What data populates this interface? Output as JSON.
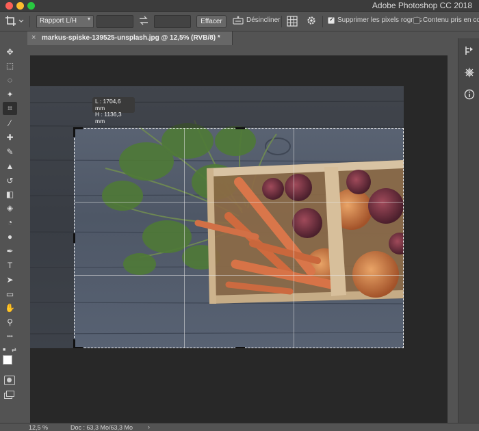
{
  "window": {
    "app_title": "Adobe Photoshop CC 2018"
  },
  "options_bar": {
    "ratio_select_value": "Rapport L/H",
    "width_value": "",
    "height_value": "",
    "clear_label": "Effacer",
    "straighten_label": "Désincliner",
    "delete_cropped_label": "Supprimer les pixels rognés",
    "delete_cropped_checked": true,
    "content_aware_label": "Contenu pris en comp",
    "content_aware_checked": false
  },
  "document": {
    "tab_title": "markus-spiske-139525-unsplash.jpg @ 12,5% (RVB/8) *"
  },
  "crop_tooltip": {
    "width_line": "L : 1704,6 mm",
    "height_line": "H : 1136,3 mm"
  },
  "toolbar": {
    "tools": [
      {
        "name": "move-tool-icon",
        "glyph": "✥"
      },
      {
        "name": "marquee-tool-icon",
        "glyph": "⬚"
      },
      {
        "name": "lasso-tool-icon",
        "glyph": "◌"
      },
      {
        "name": "magic-wand-tool-icon",
        "glyph": "✦"
      },
      {
        "name": "crop-tool-icon",
        "glyph": "⌗",
        "active": true
      },
      {
        "name": "eyedropper-tool-icon",
        "glyph": "⁄"
      },
      {
        "name": "healing-brush-tool-icon",
        "glyph": "✚"
      },
      {
        "name": "brush-tool-icon",
        "glyph": "✎"
      },
      {
        "name": "clone-stamp-tool-icon",
        "glyph": "▲"
      },
      {
        "name": "history-brush-tool-icon",
        "glyph": "↺"
      },
      {
        "name": "eraser-tool-icon",
        "glyph": "◧"
      },
      {
        "name": "paint-bucket-tool-icon",
        "glyph": "◈"
      },
      {
        "name": "blur-tool-icon",
        "glyph": "◔"
      },
      {
        "name": "dodge-tool-icon",
        "glyph": "●"
      },
      {
        "name": "pen-tool-icon",
        "glyph": "✒"
      },
      {
        "name": "type-tool-icon",
        "glyph": "T"
      },
      {
        "name": "path-selection-tool-icon",
        "glyph": "➤"
      },
      {
        "name": "rectangle-tool-icon",
        "glyph": "▭"
      },
      {
        "name": "hand-tool-icon",
        "glyph": "✋"
      },
      {
        "name": "zoom-tool-icon",
        "glyph": "⚲"
      },
      {
        "name": "more-tools-icon",
        "glyph": "•••"
      }
    ]
  },
  "status_bar": {
    "zoom": "12,5 %",
    "doc_info": "Doc : 63,3 Mo/63,3 Mo",
    "arrow": "›"
  },
  "colors": {
    "app_bg": "#535353",
    "canvas_bg": "#282828",
    "photo_wood": "#556070"
  }
}
